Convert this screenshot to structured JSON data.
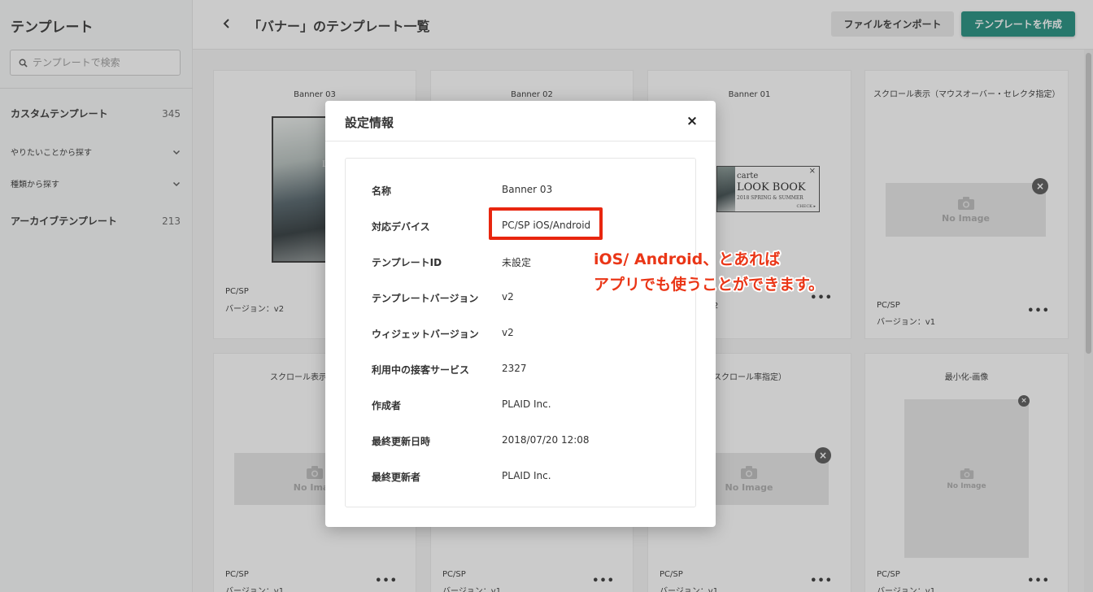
{
  "sidebar": {
    "title": "テンプレート",
    "search_placeholder": "テンプレートで検索",
    "custom": {
      "label": "カスタムテンプレート",
      "count": "345"
    },
    "filter_purpose": "やりたいことから探す",
    "filter_type": "種類から探す",
    "archive": {
      "label": "アーカイブテンプレート",
      "count": "213"
    }
  },
  "header": {
    "title": "「バナー」のテンプレート一覧",
    "import_label": "ファイルをインポート",
    "create_label": "テンプレートを作成"
  },
  "cards": [
    {
      "title": "Banner 03",
      "device": "PC/SP",
      "version": "バージョン：v2"
    },
    {
      "title": "Banner 02",
      "device": "",
      "version": ""
    },
    {
      "title": "Banner 01",
      "device": "",
      "version": "2"
    },
    {
      "title": "スクロール表示（マウスオーバー・セレクタ指定）",
      "device": "PC/SP",
      "version": "バージョン：v1"
    },
    {
      "title": "スクロール表示（ボトム",
      "device": "PC/SP",
      "version": "バージョン：v1"
    },
    {
      "title": "",
      "device": "PC/SP",
      "version": "バージョン：v1"
    },
    {
      "title": "ル表示（スクロール率指定）",
      "device": "PC/SP",
      "version": "バージョン：v1"
    },
    {
      "title": "最小化-画像",
      "device": "PC/SP",
      "version": "バージョン：v1"
    }
  ],
  "no_image_label": "No Image",
  "no_image_partial": "No Imag",
  "banner01": {
    "brand": "carte",
    "headline": "LOOK BOOK",
    "sub": "2018 SPRING & SUMMER",
    "cta": "CHECK ▸"
  },
  "banner03_photo_text": "L",
  "modal": {
    "title": "設定情報",
    "close": "×",
    "rows": [
      {
        "key": "名称",
        "value": "Banner 03"
      },
      {
        "key": "対応デバイス",
        "value": "PC/SP iOS/Android"
      },
      {
        "key": "テンプレートID",
        "value": "未設定"
      },
      {
        "key": "テンプレートバージョン",
        "value": "v2"
      },
      {
        "key": "ウィジェットバージョン",
        "value": "v2"
      },
      {
        "key": "利用中の接客サービス",
        "value": "2327"
      },
      {
        "key": "作成者",
        "value": "PLAID Inc."
      },
      {
        "key": "最終更新日時",
        "value": "2018/07/20 12:08"
      },
      {
        "key": "最終更新者",
        "value": "PLAID Inc."
      }
    ]
  },
  "annotation": {
    "line1": "iOS/ Android、とあれば",
    "line2": "アプリでも使うことができます。"
  },
  "colors": {
    "accent": "#1c8c7c",
    "annotation": "#ea3617",
    "highlight": "#e8260f"
  }
}
